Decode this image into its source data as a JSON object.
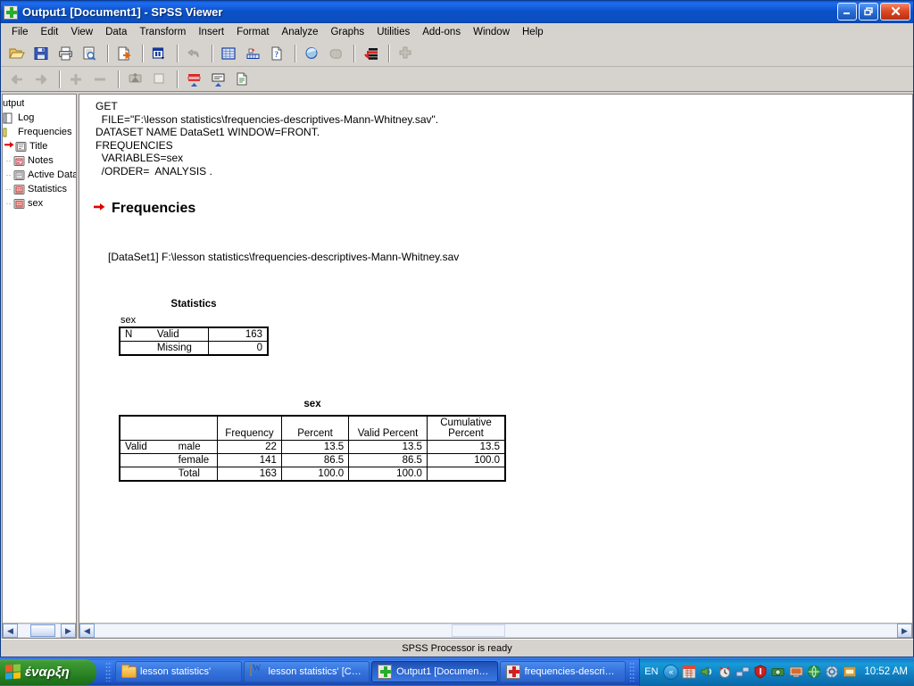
{
  "window": {
    "title": "Output1 [Document1] - SPSS Viewer",
    "icon": "spss-icon",
    "minimize_label": "Minimize",
    "restore_label": "Restore",
    "close_label": "Close"
  },
  "menubar": {
    "items": [
      {
        "label": "File"
      },
      {
        "label": "Edit"
      },
      {
        "label": "View"
      },
      {
        "label": "Data"
      },
      {
        "label": "Transform"
      },
      {
        "label": "Insert"
      },
      {
        "label": "Format"
      },
      {
        "label": "Analyze"
      },
      {
        "label": "Graphs"
      },
      {
        "label": "Utilities"
      },
      {
        "label": "Add-ons"
      },
      {
        "label": "Window"
      },
      {
        "label": "Help"
      }
    ]
  },
  "toolbar_main": {
    "buttons": [
      {
        "name": "open-file-icon",
        "title": "Open"
      },
      {
        "name": "save-icon",
        "title": "Save"
      },
      {
        "name": "print-icon",
        "title": "Print"
      },
      {
        "name": "print-preview-icon",
        "title": "Print Preview"
      },
      {
        "name": "export-icon",
        "title": "Export"
      },
      {
        "name": "recall-dialog-icon",
        "title": "Recall recently used dialogs"
      },
      {
        "name": "undo-icon",
        "title": "Undo"
      },
      {
        "name": "goto-data-icon",
        "title": "Go to data"
      },
      {
        "name": "goto-case-icon",
        "title": "Go to case"
      },
      {
        "name": "variables-icon",
        "title": "Variables"
      },
      {
        "name": "find-icon",
        "title": "Find"
      },
      {
        "name": "insert-cases-icon",
        "title": "Insert cases"
      },
      {
        "name": "insert-variable-icon",
        "title": "Insert variable"
      },
      {
        "name": "split-file-icon",
        "title": "Split file"
      }
    ]
  },
  "toolbar_outline": {
    "buttons": [
      {
        "name": "promote-icon",
        "title": "Promote"
      },
      {
        "name": "demote-icon",
        "title": "Demote"
      },
      {
        "name": "expand-icon",
        "title": "Expand"
      },
      {
        "name": "collapse-icon",
        "title": "Collapse"
      },
      {
        "name": "show-icon",
        "title": "Show"
      },
      {
        "name": "hide-icon",
        "title": "Hide"
      },
      {
        "name": "insert-heading-icon",
        "title": "Insert heading"
      },
      {
        "name": "insert-title-icon",
        "title": "Insert title"
      },
      {
        "name": "insert-text-icon",
        "title": "Insert text"
      }
    ]
  },
  "outline": {
    "items": [
      {
        "label": "utput",
        "icon": "output-icon",
        "indent": 0,
        "selected_arrow": false,
        "dots": false
      },
      {
        "label": "Log",
        "icon": "log-icon",
        "indent": 1,
        "selected_arrow": false,
        "dots": false
      },
      {
        "label": "Frequencies",
        "icon": "folder-open-icon",
        "indent": 1,
        "selected_arrow": false,
        "dots": false
      },
      {
        "label": "Title",
        "icon": "title-icon",
        "indent": 2,
        "selected_arrow": true,
        "dots": false
      },
      {
        "label": "Notes",
        "icon": "notes-icon",
        "indent": 2,
        "selected_arrow": false,
        "dots": true
      },
      {
        "label": "Active Data",
        "icon": "active-dataset-icon",
        "indent": 2,
        "selected_arrow": false,
        "dots": true
      },
      {
        "label": "Statistics",
        "icon": "table-icon",
        "indent": 2,
        "selected_arrow": false,
        "dots": true
      },
      {
        "label": "sex",
        "icon": "table-icon",
        "indent": 2,
        "selected_arrow": false,
        "dots": true
      }
    ]
  },
  "output": {
    "syntax": "GET\n  FILE=\"F:\\lesson statistics\\frequencies-descriptives-Mann-Whitney.sav\".\nDATASET NAME DataSet1 WINDOW=FRONT.\nFREQUENCIES\n  VARIABLES=sex\n  /ORDER=  ANALYSIS .",
    "heading": "Frequencies",
    "dataset_line": "[DataSet1] F:\\lesson statistics\\frequencies-descriptives-Mann-Whitney.sav",
    "statistics_table": {
      "caption": "Statistics",
      "corner_label": "sex",
      "rows": [
        {
          "group": "N",
          "label": "Valid",
          "value": "163"
        },
        {
          "group": "",
          "label": "Missing",
          "value": "0"
        }
      ]
    },
    "frequency_table": {
      "caption": "sex",
      "columns": [
        "Frequency",
        "Percent",
        "Valid Percent",
        "Cumulative Percent"
      ],
      "column_lines": [
        [
          "Frequency"
        ],
        [
          "Percent"
        ],
        [
          "Valid Percent"
        ],
        [
          "Cumulative",
          "Percent"
        ]
      ],
      "row_group": "Valid",
      "rows": [
        {
          "category": "male",
          "frequency": "22",
          "percent": "13.5",
          "valid_percent": "13.5",
          "cumulative_percent": "13.5"
        },
        {
          "category": "female",
          "frequency": "141",
          "percent": "86.5",
          "valid_percent": "86.5",
          "cumulative_percent": "100.0"
        },
        {
          "category": "Total",
          "frequency": "163",
          "percent": "100.0",
          "valid_percent": "100.0",
          "cumulative_percent": ""
        }
      ]
    }
  },
  "statusbar": {
    "message": "SPSS Processor is ready"
  },
  "scrollbars": {
    "left_arrow": "◀",
    "right_arrow": "▶"
  },
  "taskbar": {
    "start_label": "έναρξη",
    "buttons": [
      {
        "label": "lesson statistics'",
        "icon": "folder-icon",
        "active": false
      },
      {
        "label": "lesson statistics' [C…",
        "icon": "word-icon",
        "active": false
      },
      {
        "label": "Output1 [Documen…",
        "icon": "spss-viewer-icon",
        "active": true
      },
      {
        "label": "frequencies-descri…",
        "icon": "spss-data-icon",
        "active": false
      }
    ],
    "tray": {
      "language": "EN",
      "chevron": "«",
      "icons": [
        {
          "name": "calendar-tray-icon",
          "color": "#d94a3a"
        },
        {
          "name": "volume-tray-icon",
          "color": "#5ca83a"
        },
        {
          "name": "alarm-tray-icon",
          "color": "#c0392b"
        },
        {
          "name": "network-tray-icon",
          "color": "#4a7fd6"
        },
        {
          "name": "shield-tray-icon",
          "color": "#cc2222"
        },
        {
          "name": "camera-tray-icon",
          "color": "#3f8f3f"
        },
        {
          "name": "display-tray-icon",
          "color": "#d96a2a"
        },
        {
          "name": "globe-tray-icon",
          "color": "#2f9e44"
        },
        {
          "name": "antivirus-tray-icon",
          "color": "#bcd6e8"
        },
        {
          "name": "folder-tray-icon",
          "color": "#e8a93a"
        }
      ],
      "clock": "10:52 AM"
    }
  }
}
